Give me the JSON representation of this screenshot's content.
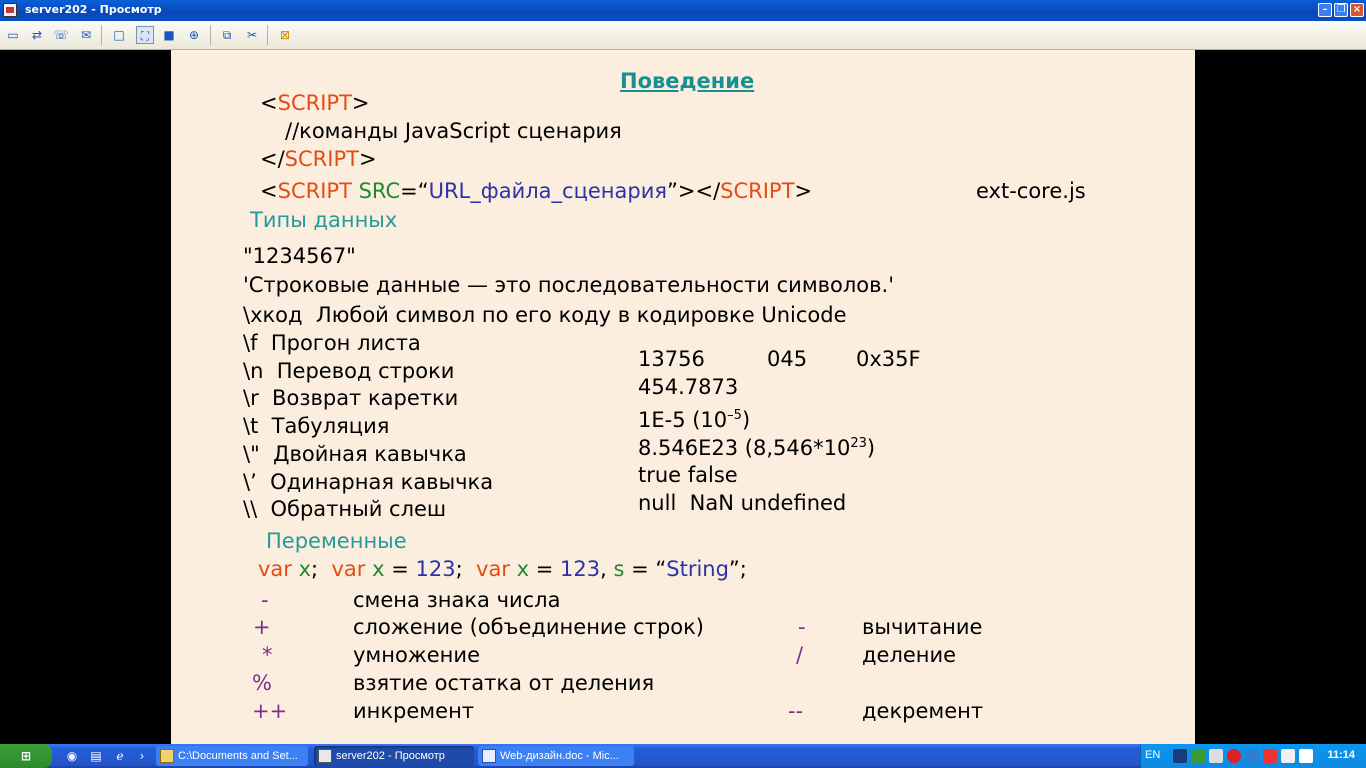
{
  "window": {
    "title": "server202 - Просмотр",
    "minimize": "–",
    "restore": "❐",
    "close": "×"
  },
  "toolbar": {
    "icons": [
      "monitor-icon",
      "transfer-icon",
      "phone-icon",
      "chat-icon",
      "window-icon",
      "fullscreen-icon",
      "fit-icon",
      "zoom-icon",
      "clipboard-icon",
      "tools-icon",
      "close-session-icon"
    ]
  },
  "slide": {
    "heading": "Поведение",
    "script_open_lt": "<",
    "script_open_tag": "SCRIPT",
    "script_open_gt": ">",
    "comment": "//команды JavaScript сценария",
    "script_close_lt": "</",
    "script_close_tag": "SCRIPT",
    "script_close_gt": ">",
    "src_lt": "<",
    "src_tag": "SCRIPT",
    "src_attr": " SRC",
    "src_eq": "=“",
    "src_value": "URL_файла_сценария",
    "src_end": "”></",
    "src_close_tag": "SCRIPT",
    "src_close_gt": ">",
    "ext_file": "ext-core.js",
    "types_heading": "Типы данных",
    "string_example": "\"1234567\"",
    "string_desc": "'Строковые данные — это последовательности символов.'",
    "xcode_line": "\\xкод  Любой символ по его коду в кодировке Unicode",
    "escapes": [
      "\\f  Прогон листа",
      "\\n  Перевод строки",
      "\\r  Возврат каретки",
      "\\t  Табуляция",
      "\\\"  Двойная кавычка",
      "\\’  Одинарная кавычка",
      "\\\\  Обратный слеш"
    ],
    "numbers": {
      "int_dec": "13756",
      "int_oct": "045",
      "int_hex": "0x35F",
      "float": "454.7873",
      "exp1_main": "1E-5 (10",
      "exp1_sup": "–5",
      "exp1_end": ")",
      "exp2_main": "8.546E23 (8,546*10",
      "exp2_sup": "23",
      "exp2_end": ")",
      "bools": "true false",
      "specials": "null  NaN undefined"
    },
    "vars_heading": "Переменные",
    "var_line": {
      "kw1": "var",
      "v1": " x",
      "semi1": ";  ",
      "kw2": "var",
      "v2": " x",
      "eq2": " = ",
      "num2": "123",
      "semi2": ";  ",
      "kw3": "var",
      "v3": " x",
      "eq3": " = ",
      "num3": "123",
      "comma3": ", ",
      "s3": "s",
      "eq4": " = “",
      "str3": "String",
      "end3": "”;"
    },
    "operators": [
      {
        "op": "-",
        "desc": "смена знака числа",
        "op2": "",
        "desc2": ""
      },
      {
        "op": "+",
        "desc": "сложение (объединение строк)",
        "op2": "-",
        "desc2": "вычитание"
      },
      {
        "op": "*",
        "desc": "умножение",
        "op2": "/",
        "desc2": "деление"
      },
      {
        "op": "%",
        "desc": "взятие остатка от деления",
        "op2": "",
        "desc2": ""
      },
      {
        "op": "++",
        "desc": "инкремент",
        "op2": "--",
        "desc2": "декремент"
      }
    ]
  },
  "taskbar": {
    "start": "⊞",
    "tasks": [
      {
        "label": "C:\\Documents and Set..."
      },
      {
        "label": "server202 - Просмотр"
      },
      {
        "label": "Web-дизайн.doc - Mic..."
      }
    ],
    "lang": "EN",
    "clock": "11:14"
  }
}
